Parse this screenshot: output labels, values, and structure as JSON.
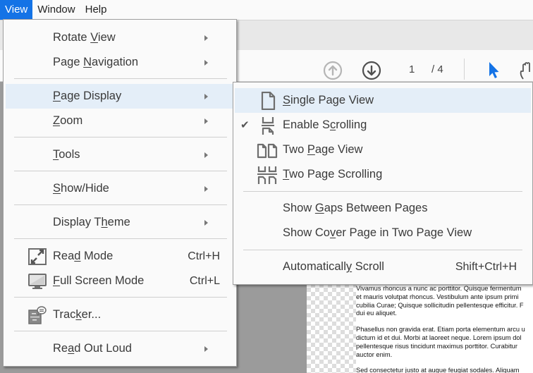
{
  "menubar": {
    "items": [
      {
        "label": "View",
        "active": true
      },
      {
        "label": "Window",
        "active": false
      },
      {
        "label": "Help",
        "active": false
      }
    ]
  },
  "toolbar": {
    "prev_page_icon": "arrow-up-circle-icon",
    "next_page_icon": "arrow-down-circle-icon",
    "current_page": "1",
    "total_pages": "/ 4",
    "select_tool_icon": "cursor-arrow-icon",
    "hand_tool_icon": "hand-icon"
  },
  "view_menu": {
    "items": [
      {
        "pre": "Rotate ",
        "ul": "V",
        "post": "iew",
        "submenu": true
      },
      {
        "pre": "Page ",
        "ul": "N",
        "post": "avigation",
        "submenu": true
      },
      {
        "pre": "",
        "ul": "P",
        "post": "age Display",
        "submenu": true,
        "highlighted": true
      },
      {
        "pre": "",
        "ul": "Z",
        "post": "oom",
        "submenu": true
      },
      {
        "pre": "",
        "ul": "T",
        "post": "ools",
        "submenu": true
      },
      {
        "pre": "",
        "ul": "S",
        "post": "how/Hide",
        "submenu": true
      },
      {
        "pre": "Display T",
        "ul": "h",
        "post": "eme",
        "submenu": true
      },
      {
        "pre": "Rea",
        "ul": "d",
        "post": " Mode",
        "shortcut": "Ctrl+H",
        "icon": "read-mode-icon"
      },
      {
        "pre": "",
        "ul": "F",
        "post": "ull Screen Mode",
        "shortcut": "Ctrl+L",
        "icon": "monitor-icon"
      },
      {
        "pre": "Trac",
        "ul": "k",
        "post": "er...",
        "icon": "tracker-icon"
      },
      {
        "pre": "Re",
        "ul": "a",
        "post": "d Out Loud",
        "submenu": true
      }
    ]
  },
  "page_display_submenu": {
    "items": [
      {
        "pre": "",
        "ul": "S",
        "post": "ingle Page View",
        "icon": "single-page-icon",
        "highlighted": true
      },
      {
        "pre": "Enable S",
        "ul": "c",
        "post": "rolling",
        "icon": "enable-scrolling-icon",
        "checked": true
      },
      {
        "pre": "Two ",
        "ul": "P",
        "post": "age View",
        "icon": "two-page-icon"
      },
      {
        "pre": "",
        "ul": "T",
        "post": "wo Page Scrolling",
        "icon": "two-page-scrolling-icon"
      },
      {
        "pre": "Show ",
        "ul": "G",
        "post": "aps Between Pages"
      },
      {
        "pre": "Show Co",
        "ul": "v",
        "post": "er Page in Two Page View"
      },
      {
        "pre": "Automaticall",
        "ul": "y",
        "post": " Scroll",
        "shortcut": "Shift+Ctrl+H"
      }
    ],
    "check_mark": "✔"
  },
  "document": {
    "paragraphs": [
      [
        "Vivamus rhoncus a nunc ac porttitor. Quisque fermentum",
        "et mauris volutpat rhoncus. Vestibulum ante ipsum primi",
        "cubilia Curae; Quisque sollicitudin pellentesque efficitur. F",
        "dui eu aliquet."
      ],
      [
        "Phasellus non gravida erat. Etiam porta elementum arcu u",
        "dictum id et dui. Morbi at laoreet neque. Lorem ipsum dol",
        "pellentesque risus tincidunt maximus porttitor. Curabitur",
        "auctor enim."
      ],
      [
        "Sed consectetur justo at augue feugiat sodales. Aliquam"
      ]
    ]
  },
  "colors": {
    "accent": "#1473e6",
    "highlight": "#e4eef8",
    "menu_bg": "#fafafa",
    "doc_bg": "#9b9b9b"
  }
}
